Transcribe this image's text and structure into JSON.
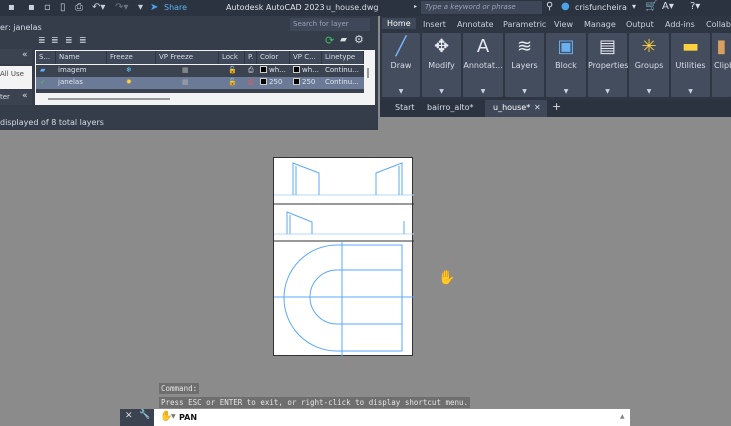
{
  "title_bar": {
    "app": "Autodesk AutoCAD 2023",
    "file": "u_house.dwg",
    "share": "Share",
    "search_placeholder": "Type a keyword or phrase",
    "user": "crisfuncheira"
  },
  "layer_panel": {
    "filter_label": "er: janelas",
    "search_placeholder": "Search for layer",
    "filter_all_used": "All Use",
    "filter_label2": "ter",
    "status": "displayed of 8 total layers",
    "columns": [
      "S...",
      "Name",
      "Freeze",
      "VP Freeze",
      "Lock",
      "P.",
      "Color",
      "VP C...",
      "Linetype"
    ],
    "rows": [
      {
        "name": "imagem",
        "color": "wh...",
        "vp_color": "wh...",
        "linetype": "Continu...",
        "selected": false
      },
      {
        "name": "janelas",
        "color": "250",
        "vp_color": "250",
        "linetype": "Continu...",
        "selected": true
      }
    ]
  },
  "ribbon": {
    "tabs": [
      "Home",
      "Insert",
      "Annotate",
      "Parametric",
      "View",
      "Manage",
      "Output",
      "Add-ins",
      "Collab"
    ],
    "panels": [
      "Draw",
      "Modify",
      "Annotat...",
      "Layers",
      "Block",
      "Properties",
      "Groups",
      "Utilities",
      "Clipb"
    ]
  },
  "doc_tabs": {
    "start": "Start",
    "tab1": "bairro_alto*",
    "tab2": "u_house*"
  },
  "command": {
    "line1": "Command:",
    "line2": "Press ESC or ENTER to exit, or right-click to display shortcut menu.",
    "current": "PAN"
  }
}
